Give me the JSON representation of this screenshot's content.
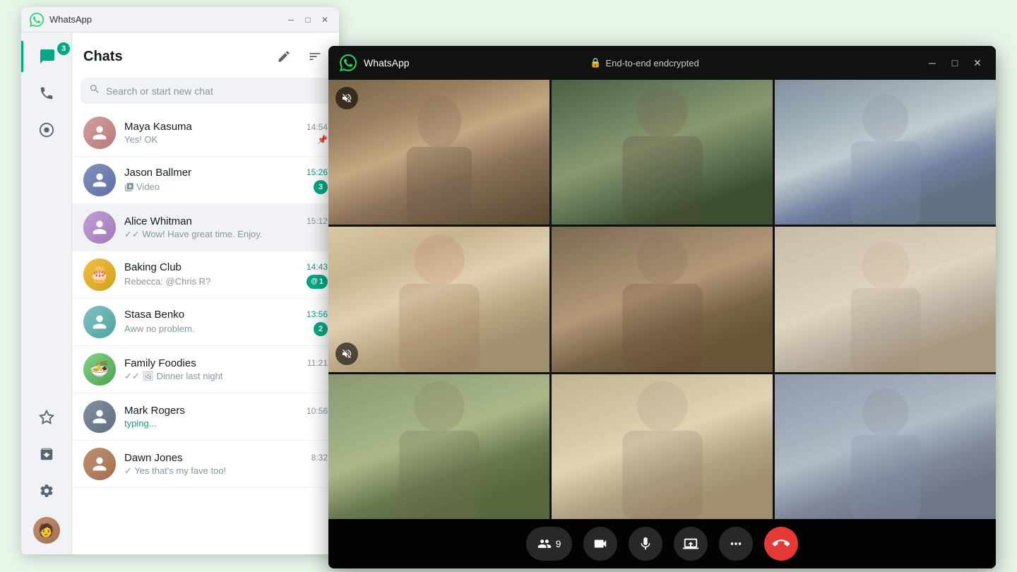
{
  "app": {
    "title": "WhatsApp",
    "encryption_label": "End-to-end endcrypted"
  },
  "sidebar": {
    "chats_badge": "3",
    "items": [
      {
        "id": "chats",
        "icon": "💬",
        "active": true,
        "badge": "3"
      },
      {
        "id": "calls",
        "icon": "📞",
        "active": false
      },
      {
        "id": "status",
        "icon": "⊙",
        "active": false
      }
    ],
    "bottom_items": [
      {
        "id": "starred",
        "icon": "☆"
      },
      {
        "id": "archived",
        "icon": "🗃"
      },
      {
        "id": "settings",
        "icon": "⚙"
      }
    ]
  },
  "chats_panel": {
    "title": "Chats",
    "search_placeholder": "Search or start new chat",
    "new_chat_icon": "✏",
    "filter_icon": "≡"
  },
  "chat_list": [
    {
      "id": "maya",
      "name": "Maya Kasuma",
      "preview": "Yes! OK",
      "time": "14:54",
      "time_green": false,
      "unread": 0,
      "pinned": true,
      "avatar_color": "#d4a0a0",
      "avatar_emoji": "👩"
    },
    {
      "id": "jason",
      "name": "Jason Ballmer",
      "preview": "🎬 Video",
      "time": "15:26",
      "time_green": true,
      "unread": 3,
      "pinned": false,
      "avatar_color": "#a0b4d4",
      "avatar_emoji": "👫"
    },
    {
      "id": "alice",
      "name": "Alice Whitman",
      "preview": "✓✓ Wow! Have great time. Enjoy.",
      "time": "15:12",
      "time_green": false,
      "unread": 0,
      "pinned": false,
      "active": true,
      "avatar_color": "#c4a0d4",
      "avatar_emoji": "👩"
    },
    {
      "id": "baking",
      "name": "Baking Club",
      "preview": "Rebecca: @Chris R?",
      "time": "14:43",
      "time_green": true,
      "unread": 1,
      "mention": true,
      "pinned": false,
      "avatar_color": "#f0c040",
      "avatar_emoji": "🎂"
    },
    {
      "id": "stasa",
      "name": "Stasa Benko",
      "preview": "Aww no problem.",
      "time": "13:56",
      "time_green": true,
      "unread": 2,
      "pinned": false,
      "avatar_color": "#80c4c4",
      "avatar_emoji": "👩"
    },
    {
      "id": "foodies",
      "name": "Family Foodies",
      "preview": "✓✓ 🖼 Dinner last night",
      "time": "11:21",
      "time_green": false,
      "unread": 0,
      "pinned": false,
      "avatar_color": "#80d480",
      "avatar_emoji": "🍜"
    },
    {
      "id": "mark",
      "name": "Mark Rogers",
      "preview": "typing...",
      "typing": true,
      "time": "10:56",
      "time_green": false,
      "unread": 0,
      "pinned": false,
      "avatar_color": "#8090a0",
      "avatar_emoji": "👨"
    },
    {
      "id": "dawn",
      "name": "Dawn Jones",
      "preview": "✓ Yes that's my fave too!",
      "time": "8:32",
      "time_green": false,
      "unread": 0,
      "pinned": false,
      "avatar_color": "#c09070",
      "avatar_emoji": "🧑"
    }
  ],
  "video_call": {
    "participants_count": "9",
    "buttons": {
      "participants": "9",
      "video": "📹",
      "mic": "🎤",
      "screen_share": "⬆",
      "more": "•••",
      "end_call": "📞"
    },
    "cells": [
      {
        "id": "cell1",
        "muted_top": true,
        "highlighted": false,
        "bg": "video-bg-1"
      },
      {
        "id": "cell2",
        "muted_top": false,
        "highlighted": false,
        "bg": "video-bg-2"
      },
      {
        "id": "cell3",
        "muted_top": false,
        "highlighted": false,
        "bg": "video-bg-3"
      },
      {
        "id": "cell4",
        "muted_top": true,
        "highlighted": false,
        "bg": "video-bg-4"
      },
      {
        "id": "cell5",
        "muted_top": false,
        "highlighted": true,
        "bg": "video-bg-5"
      },
      {
        "id": "cell6",
        "muted_top": false,
        "highlighted": false,
        "bg": "video-bg-6"
      },
      {
        "id": "cell7",
        "muted_top": false,
        "highlighted": false,
        "bg": "video-bg-7"
      },
      {
        "id": "cell8",
        "muted_top": false,
        "highlighted": false,
        "bg": "video-bg-8"
      },
      {
        "id": "cell9",
        "muted_top": false,
        "highlighted": false,
        "bg": "video-bg-9"
      }
    ]
  }
}
